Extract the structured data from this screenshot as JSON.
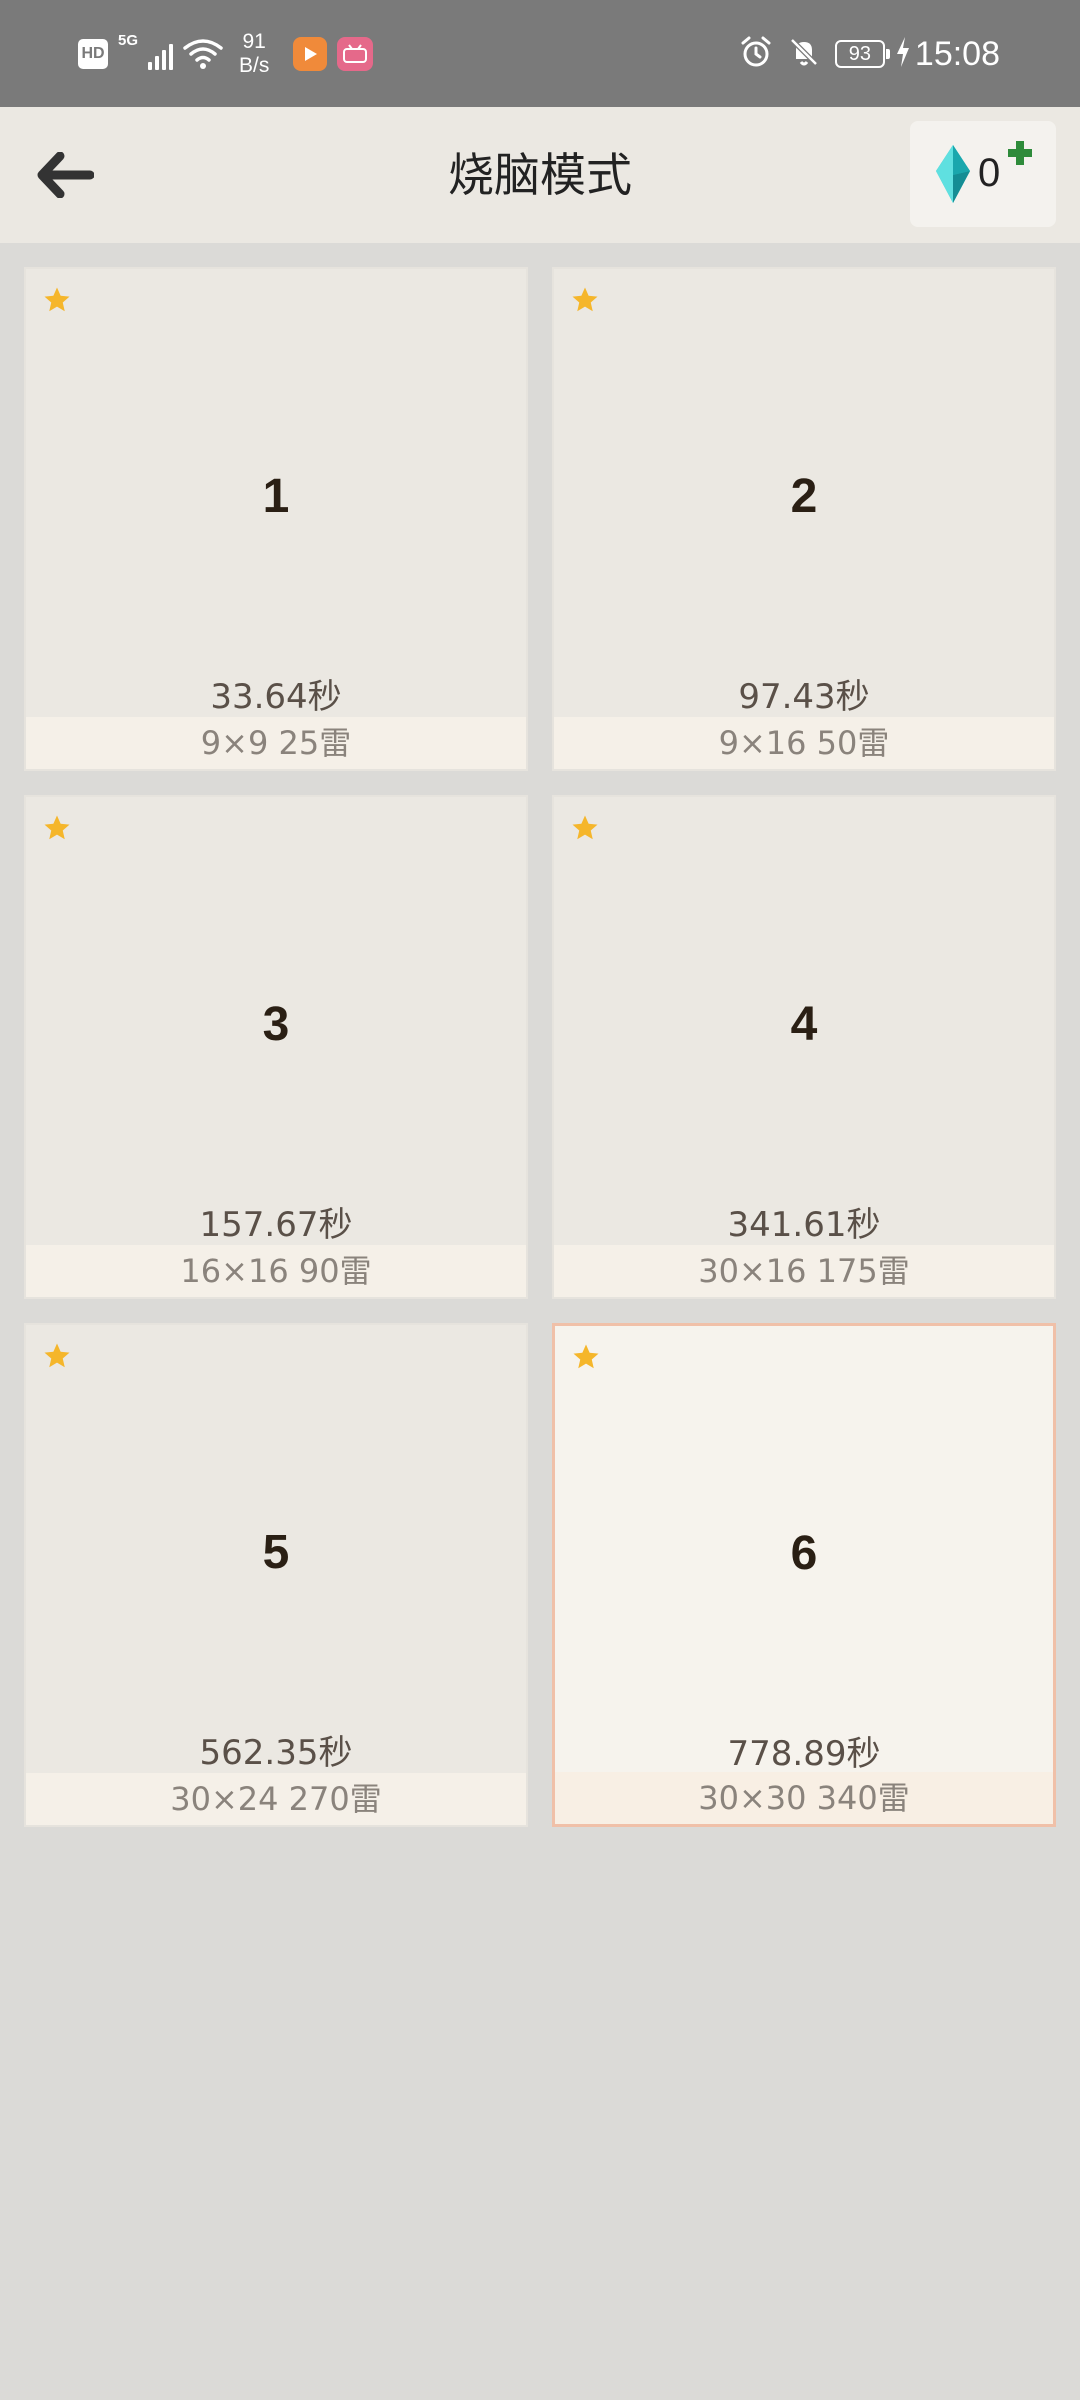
{
  "status_bar": {
    "hd_label": "HD",
    "network_label": "5G",
    "speed_value": "91",
    "speed_unit": "B/s",
    "battery": "93",
    "time": "15:08",
    "icons": [
      "hd-icon",
      "signal-icon",
      "wifi-icon",
      "app-notification-icon",
      "bilibili-icon",
      "alarm-icon",
      "mute-icon",
      "battery-icon",
      "charging-icon"
    ]
  },
  "app_bar": {
    "title": "烧脑模式",
    "gem_count": "0",
    "colors": {
      "gem": "#2bc7c8",
      "plus": "#2e8b3a"
    }
  },
  "levels": [
    {
      "number": "1",
      "time": "33.64秒",
      "info": "9×9  25雷",
      "selected": false
    },
    {
      "number": "2",
      "time": "97.43秒",
      "info": "9×16  50雷",
      "selected": false
    },
    {
      "number": "3",
      "time": "157.67秒",
      "info": "16×16  90雷",
      "selected": false
    },
    {
      "number": "4",
      "time": "341.61秒",
      "info": "30×16  175雷",
      "selected": false
    },
    {
      "number": "5",
      "time": "562.35秒",
      "info": "30×24  270雷",
      "selected": false
    },
    {
      "number": "6",
      "time": "778.89秒",
      "info": "30×30  340雷",
      "selected": true
    }
  ],
  "colors": {
    "star": "#f5b62b",
    "selected_border": "#f0c0a8",
    "background": "#dbdad7"
  }
}
